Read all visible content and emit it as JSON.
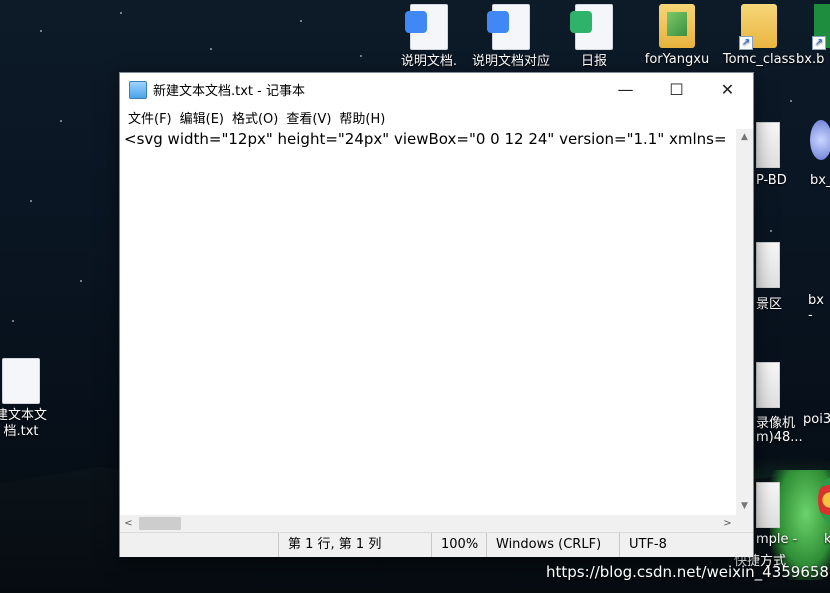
{
  "desktop": {
    "top_icons": [
      {
        "label": "说明文档.",
        "icon": "wps-writer-doc-icon"
      },
      {
        "label": "说明文档对应",
        "icon": "wps-writer-doc-icon"
      },
      {
        "label": "日报",
        "icon": "wps-spreadsheet-icon"
      },
      {
        "label": "forYangxu",
        "icon": "image-folder-icon"
      },
      {
        "label": "Tomc_class",
        "icon": "folder-shortcut-icon"
      },
      {
        "label": "bx.b",
        "icon": "shortcut-icon"
      }
    ],
    "left_icon": {
      "line1": "建文本文",
      "line2": "档.txt",
      "icon": "text-file-icon"
    },
    "right_partial_labels": [
      "P-BD",
      "bx_",
      "景区",
      "bx -",
      "录像机",
      "poi3",
      "m)48...",
      "mple -",
      "快捷方式",
      "k"
    ]
  },
  "notepad": {
    "title": "新建文本文档.txt - 记事本",
    "menu": [
      "文件(F)",
      "编辑(E)",
      "格式(O)",
      "查看(V)",
      "帮助(H)"
    ],
    "content": "<svg width=\"12px\" height=\"24px\" viewBox=\"0 0 12 24\" version=\"1.1\" xmlns=",
    "status": {
      "position": "第 1 行, 第 1 列",
      "zoom": "100%",
      "line_ending": "Windows (CRLF)",
      "encoding": "UTF-8"
    },
    "window_controls": {
      "minimize": "—",
      "maximize": "☐",
      "close": "✕"
    }
  },
  "watermark": "https://blog.csdn.net/weixin_43596589"
}
